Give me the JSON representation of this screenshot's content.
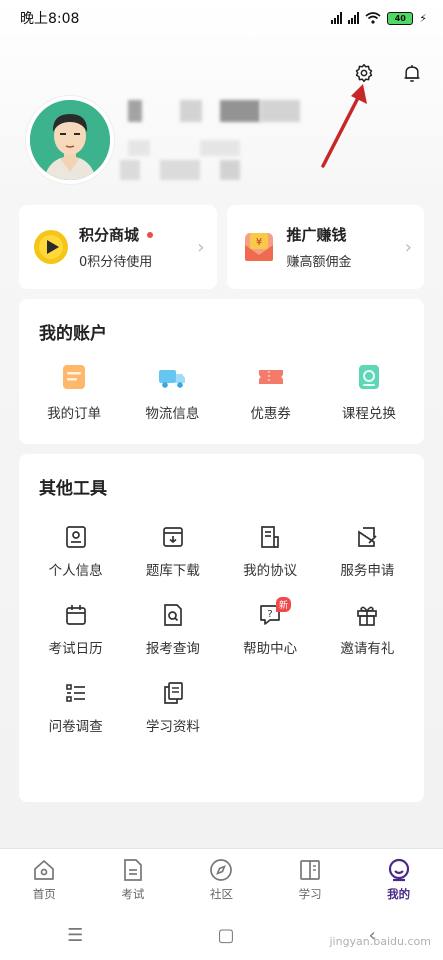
{
  "status_bar": {
    "time": "晚上8:08",
    "battery": "40"
  },
  "promos": [
    {
      "title": "积分商城",
      "subtitle": "0积分待使用"
    },
    {
      "title": "推广赚钱",
      "subtitle": "赚高额佣金"
    }
  ],
  "account": {
    "title": "我的账户",
    "items": [
      {
        "label": "我的订单"
      },
      {
        "label": "物流信息"
      },
      {
        "label": "优惠券"
      },
      {
        "label": "课程兑换"
      }
    ]
  },
  "tools": {
    "title": "其他工具",
    "badge": "新",
    "items": [
      {
        "label": "个人信息"
      },
      {
        "label": "题库下载"
      },
      {
        "label": "我的协议"
      },
      {
        "label": "服务申请"
      },
      {
        "label": "考试日历"
      },
      {
        "label": "报考查询"
      },
      {
        "label": "帮助中心"
      },
      {
        "label": "邀请有礼"
      },
      {
        "label": "问卷调查"
      },
      {
        "label": "学习资料"
      }
    ]
  },
  "tabs": [
    {
      "label": "首页"
    },
    {
      "label": "考试"
    },
    {
      "label": "社区"
    },
    {
      "label": "学习"
    },
    {
      "label": "我的"
    }
  ],
  "watermark": "jingyan.baidu.com",
  "colors": {
    "accent": "#4a2a8a",
    "badge": "#ef4a4a",
    "avatar_bg": "#3cb38c",
    "arrow": "#c62828"
  }
}
